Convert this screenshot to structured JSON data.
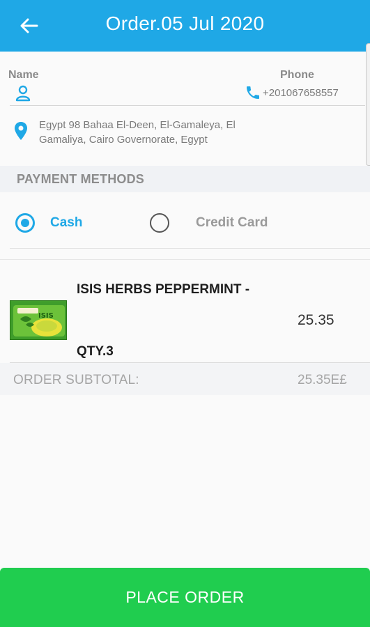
{
  "appbar": {
    "title": "Order.05 Jul 2020",
    "back_icon": "arrow-left-icon",
    "color": "#1fa8e6"
  },
  "customer": {
    "name_label": "Name",
    "name_value": "",
    "phone_label": "Phone",
    "phone_value": "+201067658557",
    "address": "Egypt 98 Bahaa El-Deen, El-Gamaleya, El Gamaliya, Cairo Governorate, Egypt"
  },
  "payment": {
    "header": "PAYMENT METHODS",
    "options": [
      {
        "label": "Cash",
        "selected": true
      },
      {
        "label": "Credit Card",
        "selected": false
      }
    ]
  },
  "items": [
    {
      "name": "ISIS HERBS PEPPERMINT -",
      "price": "25.35",
      "qty": "QTY.3"
    }
  ],
  "summary": {
    "subtotal_label": "ORDER SUBTOTAL:",
    "subtotal_value": "25.35E£"
  },
  "actions": {
    "place_order_label": "PLACE ORDER",
    "button_color": "#20cd4f"
  }
}
